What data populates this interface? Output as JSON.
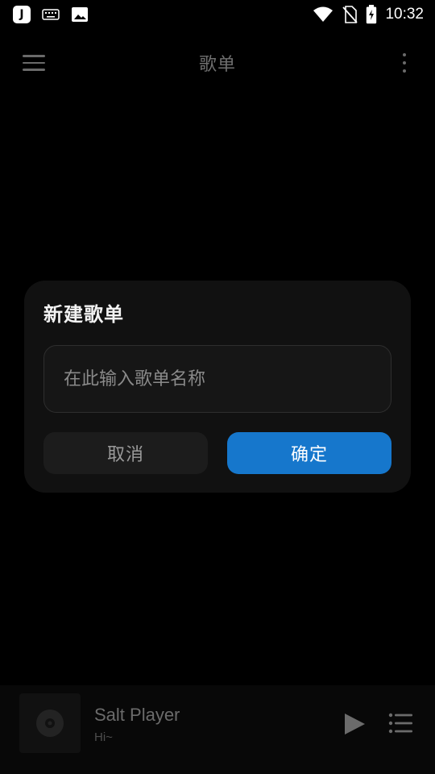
{
  "status_bar": {
    "app_icon_letter": "J",
    "time": "10:32"
  },
  "top_bar": {
    "title": "歌单"
  },
  "dialog": {
    "title": "新建歌单",
    "input_placeholder": "在此输入歌单名称",
    "input_value": "",
    "cancel_label": "取消",
    "confirm_label": "确定"
  },
  "mini_player": {
    "track_title": "Salt Player",
    "track_subtitle": "Hi~"
  },
  "colors": {
    "background": "#000000",
    "dialog_bg": "#111111",
    "accent": "#1677cc"
  },
  "icons": [
    "keyboard-icon",
    "image-icon",
    "wifi-icon",
    "no-sim-icon",
    "battery-charging-icon",
    "menu-icon",
    "more-vertical-icon",
    "album-disc-icon",
    "play-icon",
    "queue-list-icon"
  ]
}
